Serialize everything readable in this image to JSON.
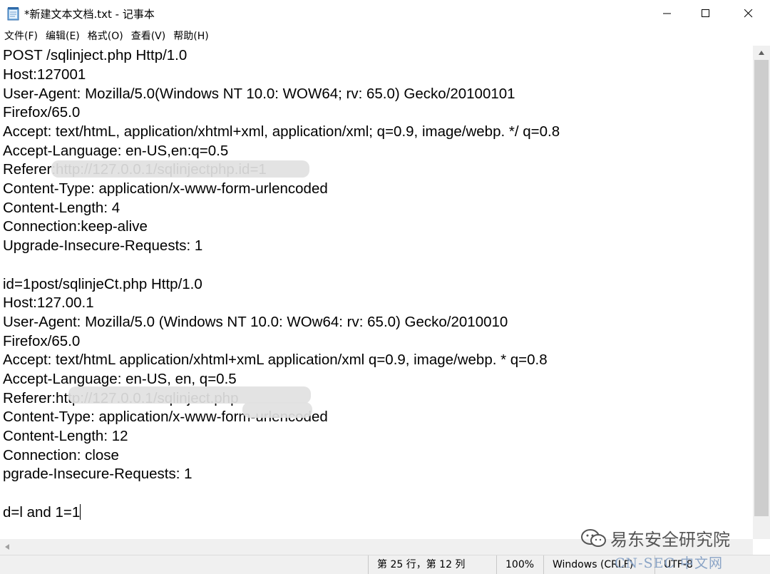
{
  "window": {
    "title": "*新建文本文档.txt - 记事本",
    "controls": {
      "minimize": "minimize",
      "maximize": "maximize",
      "close": "close"
    }
  },
  "menu": [
    "文件(F)",
    "编辑(E)",
    "格式(O)",
    "查看(V)",
    "帮助(H)"
  ],
  "editor": {
    "lines": [
      "POST /sqlinject.php Http/1.0",
      "Host:127001",
      "User-Agent: Mozilla/5.0(Windows NT 10.0: WOW64; rv: 65.0) Gecko/20100101",
      "Firefox/65.0",
      "Accept: text/htmL, application/xhtml+xml, application/xml; q=0.9, image/webp. */ q=0.8",
      "Accept-Language: en-US,en:q=0.5",
      "Referer:http://127.0.0.1/sqlinjectphp.id=1",
      "Content-Type: application/x-www-form-urlencoded",
      "Content-Length: 4",
      "Connection:keep-alive",
      "Upgrade-Insecure-Requests: 1",
      "",
      "id=1post/sqlinjeCt.php Http/1.0",
      "Host:127.00.1",
      "User-Agent: Mozilla/5.0 (Windows NT 10.0: WOw64: rv: 65.0) Gecko/2010010",
      "Firefox/65.0",
      "Accept: text/htmL application/xhtml+xmL application/xml q=0.9, image/webp. * q=0.8",
      "Accept-Language: en-US, en, q=0.5",
      "Referer:http://127.0.0.1/sqlinject.php",
      "Content-Type: application/x-www-form-urlencoded",
      "Content-Length: 12",
      "Connection: close",
      "pgrade-Insecure-Requests: 1",
      "",
      "d=l and 1=1"
    ]
  },
  "status": {
    "position": "第 25 行，第 12 列",
    "zoom": "100%",
    "line_ending": "Windows (CRLF)",
    "encoding": "UTF-8"
  },
  "watermark": {
    "brand": "易东安全研究院",
    "site": "CN-SEC 中文网"
  }
}
